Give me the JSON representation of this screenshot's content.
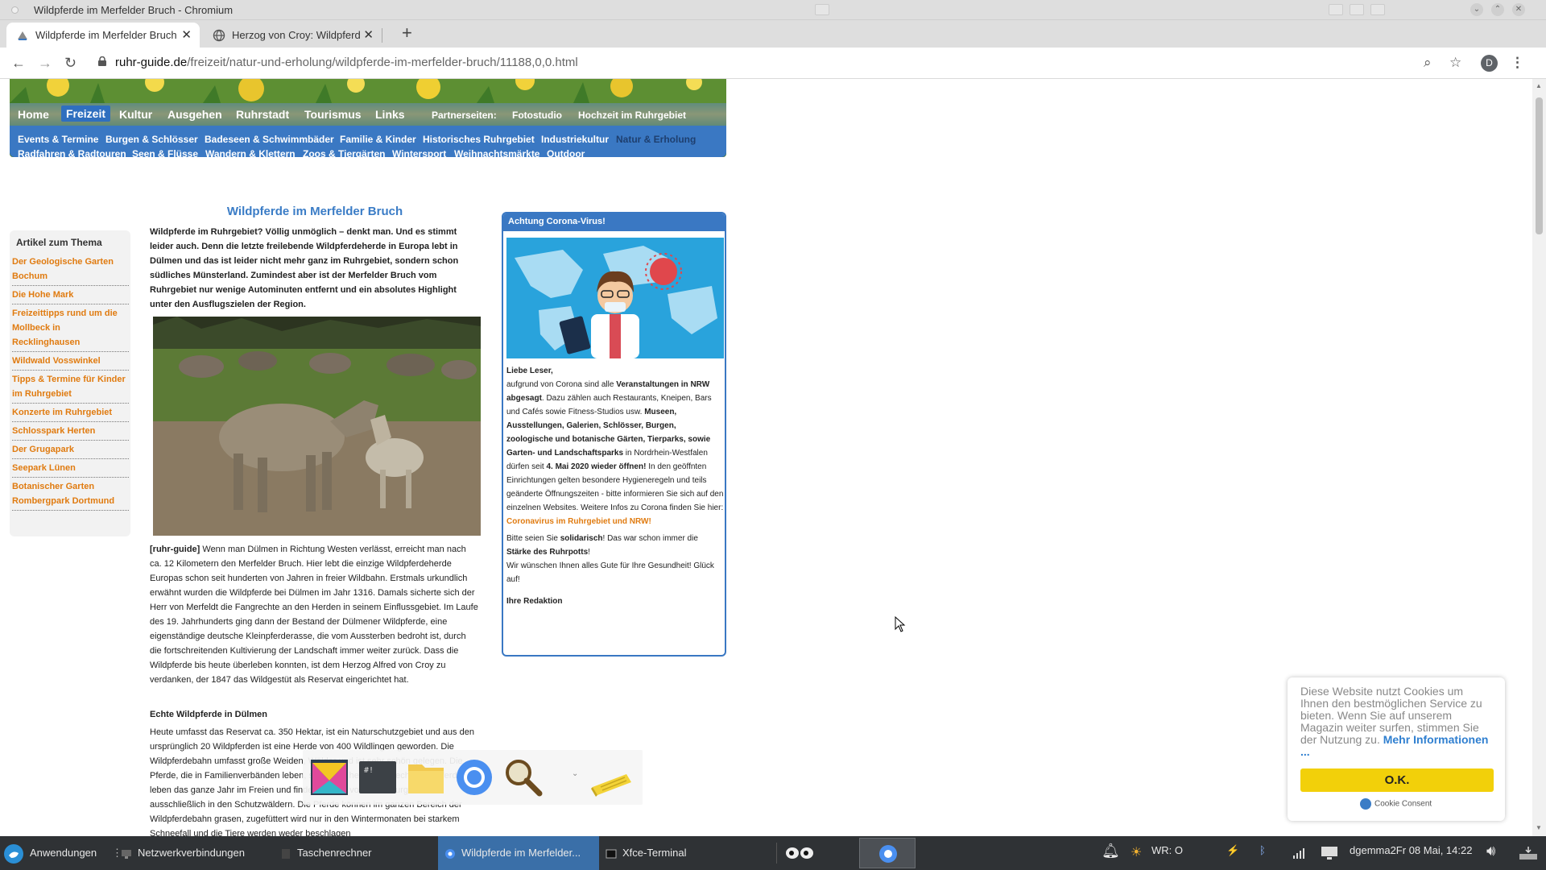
{
  "window": {
    "title": "Wildpferde im Merfelder Bruch - Chromium"
  },
  "tabs": [
    {
      "label": "Wildpferde im Merfelder Bruch",
      "active": true
    },
    {
      "label": "Herzog von Croy: Wildpferde",
      "active": false
    }
  ],
  "omnibox": {
    "host": "ruhr-guide.de",
    "path": "/freizeit/natur-und-erholung/wildpferde-im-merfelder-bruch/11188,0,0.html"
  },
  "profile_initial": "D",
  "site": {
    "main_nav": [
      "Home",
      "Freizeit",
      "Kultur",
      "Ausgehen",
      "Ruhrstadt",
      "Tourismus",
      "Links"
    ],
    "main_nav_active": "Freizeit",
    "partner_label": "Partnerseiten:",
    "partner_links": [
      "Fotostudio",
      "Hochzeit im Ruhrgebiet"
    ],
    "sub_nav_row1": [
      "Events & Termine",
      "Burgen & Schlösser",
      "Badeseen & Schwimmbäder",
      "Familie & Kinder",
      "Historisches Ruhrgebiet",
      "Industriekultur",
      "Natur & Erholung"
    ],
    "sub_nav_row2": [
      "Radfahren & Radtouren",
      "Seen & Flüsse",
      "Wandern & Klettern",
      "Zoos & Tiergärten",
      "Wintersport",
      "Weihnachtsmärkte",
      "Outdoor"
    ],
    "sub_nav_active": "Natur & Erholung"
  },
  "sidebar": {
    "heading": "Artikel zum Thema",
    "items": [
      "Der Geologische Garten Bochum",
      "Die Hohe Mark",
      "Freizeittipps rund um die Mollbeck in Recklinghausen",
      "Wildwald Vosswinkel",
      "Tipps & Termine für Kinder im Ruhrgebiet",
      "Konzerte im Ruhrgebiet",
      "Schlosspark Herten",
      "Der Grugapark",
      "Seepark Lünen",
      "Botanischer Garten Rombergpark Dortmund"
    ]
  },
  "article": {
    "title": "Wildpferde im Merfelder Bruch",
    "intro": "Wildpferde im Ruhrgebiet? Völlig unmöglich – denkt man. Und es stimmt leider auch. Denn die letzte freilebende Wildpferdeherde in Europa lebt in Dülmen und das ist leider nicht mehr ganz im Ruhrgebiet, sondern schon südliches Münsterland. Zumindest aber ist der Merfelder Bruch vom Ruhrgebiet nur wenige Autominuten entfernt und ein absolutes Highlight unter den Ausflugszielen der Region.",
    "body_tag": "[ruhr-guide]",
    "body": " Wenn man Dülmen in Richtung Westen verlässt, erreicht man nach ca. 12 Kilometern den Merfelder Bruch. Hier lebt die einzige Wildpferdeherde Europas schon seit hunderten von Jahren in freier Wildbahn. Erstmals urkundlich erwähnt wurden die Wildpferde bei Dülmen im Jahr 1316. Damals sicherte sich der Herr von Merfeldt die Fangrechte an den Herden in seinem Einflussgebiet. Im Laufe des 19. Jahrhunderts ging dann der Bestand der Dülmener Wildpferde, eine eigenständige deutsche Kleinpferderasse, die vom Aussterben bedroht ist, durch die fortschreitenden Kultivierung der Landschaft immer weiter zurück. Dass die Wildpferde bis heute überleben konnten, ist dem Herzog Alfred von Croy zu verdanken, der 1847 das Wildgestüt als Reservat eingerichtet hat.",
    "subheading": "Echte Wildpferde in Dülmen",
    "body2": "Heute umfasst das Reservat ca. 350 Hektar, ist ein Naturschutzgebiet und aus den ursprünglich 20 Wildpferden ist eine Herde von 400 Wildlingen geworden. Die Wildpferdebahn umfasst große Weiden, Wälder und ist sehr schön gelegen. Die Pferde, die in Familienverbänden leben, sind auch heute noch echte Wildpferde: Sie leben das ganze Jahr im Freien und finden Schutz vor den Naturgewalten ausschließlich in den Schutzwäldern. Die Pferde können im ganzen Bereich der Wildpferdebahn grasen, zugefüttert wird nur in den Wintermonaten bei starkem Schneefall und die Tiere werden weder beschlagen"
  },
  "corona_box": {
    "heading": "Achtung Corona-Virus!",
    "greeting": "Liebe Leser,",
    "p1_a": "aufgrund von Corona sind alle ",
    "p1_b": "Veranstaltungen in NRW abgesagt",
    "p1_c": ". Dazu zählen auch Restaurants, Kneipen, Bars und Cafés sowie Fitness-Studios usw. ",
    "p1_d": "Museen, Ausstellungen, Galerien, Schlösser, Burgen, zoologische und botanische Gärten, Tierparks, sowie Garten- und Landschaftsparks",
    "p1_e": " in Nordrhein-Westfalen dürfen seit ",
    "p1_f": "4. Mai 2020 wieder öffnen!",
    "p1_g": " In den geöffnten Einrichtungen gelten besondere Hygieneregeln und teils geänderte Öffnungszeiten - bitte informieren Sie sich auf den einzelnen Websites. Weitere Infos zu Corona finden Sie hier:",
    "link": "Coronavirus im Ruhrgebiet und NRW!",
    "p2_a": "Bitte seien Sie ",
    "p2_b": "solidarisch",
    "p2_c": "! Das war schon immer die ",
    "p2_d": "Stärke des Ruhrpotts",
    "p2_e": "!",
    "p3": "Wir wünschen Ihnen alles Gute für Ihre Gesundheit! Glück auf!",
    "signoff": "Ihre Redaktion"
  },
  "cookie": {
    "text": "Diese Website nutzt Cookies um Ihnen den bestmöglichen Service zu bieten. Wenn Sie auf unserem Magazin weiter surfen, stimmen Sie der Nutzung zu.",
    "more": "Mehr Informationen ...",
    "ok": "O.K.",
    "brand": "Cookie Consent"
  },
  "taskbar": {
    "apps_menu": "Anwendungen",
    "items": [
      {
        "label": "Netzwerkverbindungen",
        "active": false
      },
      {
        "label": "Taschenrechner",
        "active": false
      },
      {
        "label": "Wildpferde im Merfelder...",
        "active": true
      },
      {
        "label": "Xfce-Terminal",
        "active": false
      }
    ],
    "weather": "WR: O",
    "clock": "dgemma2Fr 08 Mai, 14:22"
  },
  "colors": {
    "link_orange": "#e07b10",
    "site_blue": "#3a78c3",
    "cookie_button": "#f2d00a",
    "taskbar_bg": "#2f3235"
  }
}
